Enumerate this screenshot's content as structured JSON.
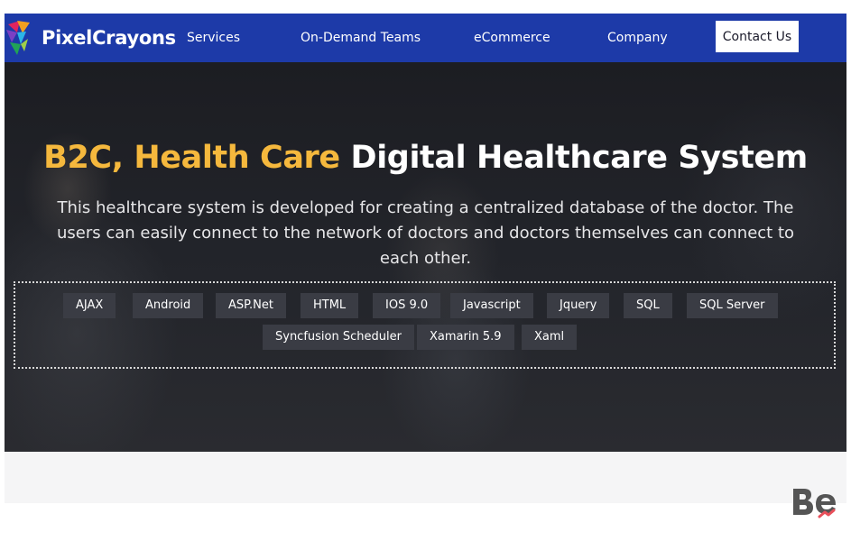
{
  "header": {
    "logo_text": "PixelCrayons",
    "nav": [
      "Services",
      "On-Demand Teams",
      "eCommerce",
      "Company"
    ],
    "cta_label": "Contact Us",
    "bg_color": "#1d3aa8"
  },
  "hero": {
    "headline_accent": "B2C, Health Care",
    "headline_main": "Digital Healthcare System",
    "accent_color": "#f5b83d",
    "description": "This healthcare system is developed for creating a centralized database of the doctor. The users can easily connect to the network of doctors and doctors themselves can connect to each other.",
    "tags": [
      "AJAX",
      "Android",
      "ASP.Net",
      "HTML",
      "IOS 9.0",
      "Javascript",
      "Jquery",
      "SQL",
      "SQL Server",
      "Syncfusion Scheduler",
      "Xamarin 5.9",
      "Xaml"
    ]
  },
  "watermark": {
    "icon": "behance-logo"
  }
}
